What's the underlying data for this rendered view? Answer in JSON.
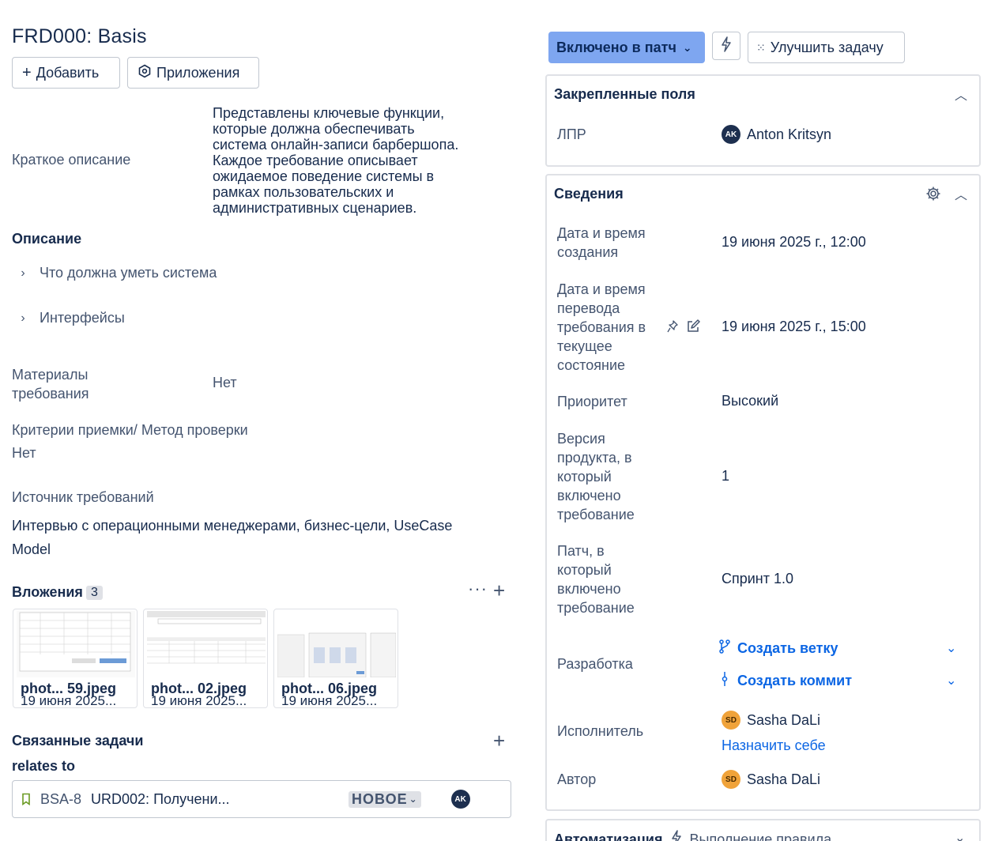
{
  "issue": {
    "title": "FRD000: Basis",
    "buttons": {
      "add": "Добавить",
      "apps": "Приложения"
    }
  },
  "fields": {
    "short_desc_label": "Краткое описание",
    "short_desc_lines": [
      "Представлены ключевые функции,",
      "которые должна обеспечивать",
      "система онлайн-записи барбершопа.",
      "Каждое требование описывает",
      "ожидаемое поведение системы в",
      "рамках пользовательских и",
      "административных сценариев."
    ],
    "description_heading": "Описание",
    "expanders": [
      "Что должна уметь система",
      "Интерфейсы"
    ],
    "materials_label_lines": [
      "Материалы",
      "требования"
    ],
    "materials_value": "Нет",
    "acceptance_label": "Критерии приемки/ Метод проверки",
    "acceptance_value": "Нет",
    "source_label": "Источник требований",
    "source_value_lines": [
      "Интервью с операционными менеджерами, бизнес-цели, UseCase",
      "Model"
    ]
  },
  "attachments": {
    "heading": "Вложения",
    "count": "3",
    "items": [
      {
        "name": "phot... 59.jpeg",
        "date": "19 июня 2025..."
      },
      {
        "name": "phot... 02.jpeg",
        "date": "19 июня 2025..."
      },
      {
        "name": "phot... 06.jpeg",
        "date": "19 июня 2025..."
      }
    ]
  },
  "linked": {
    "heading": "Связанные задачи",
    "relation": "relates to",
    "item": {
      "key": "BSA-8",
      "summary": "URD002: Получени...",
      "status": "НОВОЕ",
      "avatar": "AK"
    }
  },
  "toolbar": {
    "status_button": "Включено в патч",
    "improve_button": "Улучшить задачу"
  },
  "pinned": {
    "title": "Закрепленные поля",
    "lpr_label": "ЛПР",
    "lpr_avatar": "AK",
    "lpr_value": "Anton Kritsyn"
  },
  "details": {
    "title": "Сведения",
    "created_label_lines": [
      "Дата и время",
      "создания"
    ],
    "created_value": "19 июня 2025 г., 12:00",
    "transition_label_lines": [
      "Дата и время",
      "перевода",
      "требования в",
      "текущее",
      "состояние"
    ],
    "transition_value": "19 июня 2025 г., 15:00",
    "priority_label": "Приоритет",
    "priority_value": "Высокий",
    "version_label_lines": [
      "Версия",
      "продукта, в",
      "который",
      "включено",
      "требование"
    ],
    "version_value": "1",
    "patch_label_lines": [
      "Патч, в",
      "который",
      "включено",
      "требование"
    ],
    "patch_value": "Спринт 1.0",
    "dev_label": "Разработка",
    "create_branch": "Создать ветку",
    "create_commit": "Создать коммит",
    "assignee_label": "Исполнитель",
    "assignee_avatar": "SD",
    "assignee_value": "Sasha DaLi",
    "assign_self": "Назначить себе",
    "author_label": "Автор",
    "author_avatar": "SD",
    "author_value": "Sasha DaLi"
  },
  "automation": {
    "title": "Автоматизация",
    "rule_text": "Выполнение правила"
  },
  "colors": {
    "primary_button": "#7ea6f0",
    "link": "#0c66e4",
    "text": "#172b4d",
    "subtle": "#44546f",
    "border": "#dfe1e6"
  }
}
